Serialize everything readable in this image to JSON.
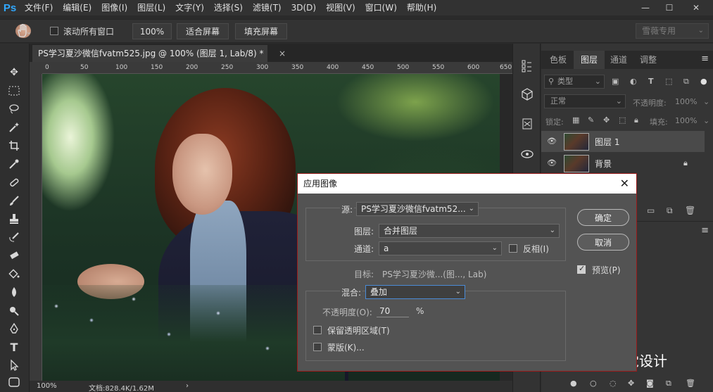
{
  "app": {
    "logo": "Ps",
    "menus": [
      "文件(F)",
      "编辑(E)",
      "图像(I)",
      "图层(L)",
      "文字(Y)",
      "选择(S)",
      "滤镜(T)",
      "3D(D)",
      "视图(V)",
      "窗口(W)",
      "帮助(H)"
    ],
    "window_controls": {
      "minimize": "—",
      "restore": "☐",
      "close": "✕"
    }
  },
  "options_bar": {
    "scroll_all_windows": "滚动所有窗口",
    "zoom_value": "100%",
    "fit_screen": "适合屏幕",
    "fill_screen": "填充屏幕",
    "workspace": "雪薇专用"
  },
  "document": {
    "tab_title": "PS学习夏沙微信fvatm525.jpg @ 100% (图层 1, Lab/8) *",
    "tab_close": "×",
    "ruler_ticks": [
      "0",
      "50",
      "100",
      "150",
      "200",
      "250",
      "300",
      "350",
      "400",
      "450",
      "500",
      "550",
      "600",
      "650"
    ]
  },
  "status": {
    "zoom": "100%",
    "doc_info": "文档:828.4K/1.62M",
    "more": "›"
  },
  "layers_panel": {
    "tabs": [
      "色板",
      "图层",
      "通道",
      "调整"
    ],
    "active_tab": "图层",
    "filter_kind": "类型",
    "blend_mode": "正常",
    "opacity_label": "不透明度:",
    "opacity_value": "100%",
    "lock_label": "锁定:",
    "fill_label": "填充:",
    "fill_value": "100%",
    "layers": [
      {
        "name": "图层 1",
        "selected": true
      },
      {
        "name": "背景",
        "selected": false,
        "locked": true
      }
    ]
  },
  "dialog": {
    "title": "应用图像",
    "source_label": "源:",
    "source_value": "PS学习夏沙微信fvatm52...",
    "layer_label": "图层:",
    "layer_value": "合并图层",
    "channel_label": "通道:",
    "channel_value": "a",
    "invert_label": "反相(I)",
    "target_label": "目标:",
    "target_value": "PS学习夏沙微...(图..., Lab)",
    "blending_label": "混合:",
    "blending_value": "叠加",
    "opacity_label": "不透明度(O):",
    "opacity_value": "70",
    "percent": "%",
    "preserve_label": "保留透明区域(T)",
    "mask_label": "蒙版(K)...",
    "ok": "确定",
    "cancel": "取消",
    "preview_label": "预览(P)",
    "preview_checked": true
  },
  "watermark": {
    "text": "创意视觉设计"
  },
  "colors": {
    "accent": "#31a8ff",
    "dialog_border": "#9b1a1a",
    "focus": "#4a8bd6"
  }
}
